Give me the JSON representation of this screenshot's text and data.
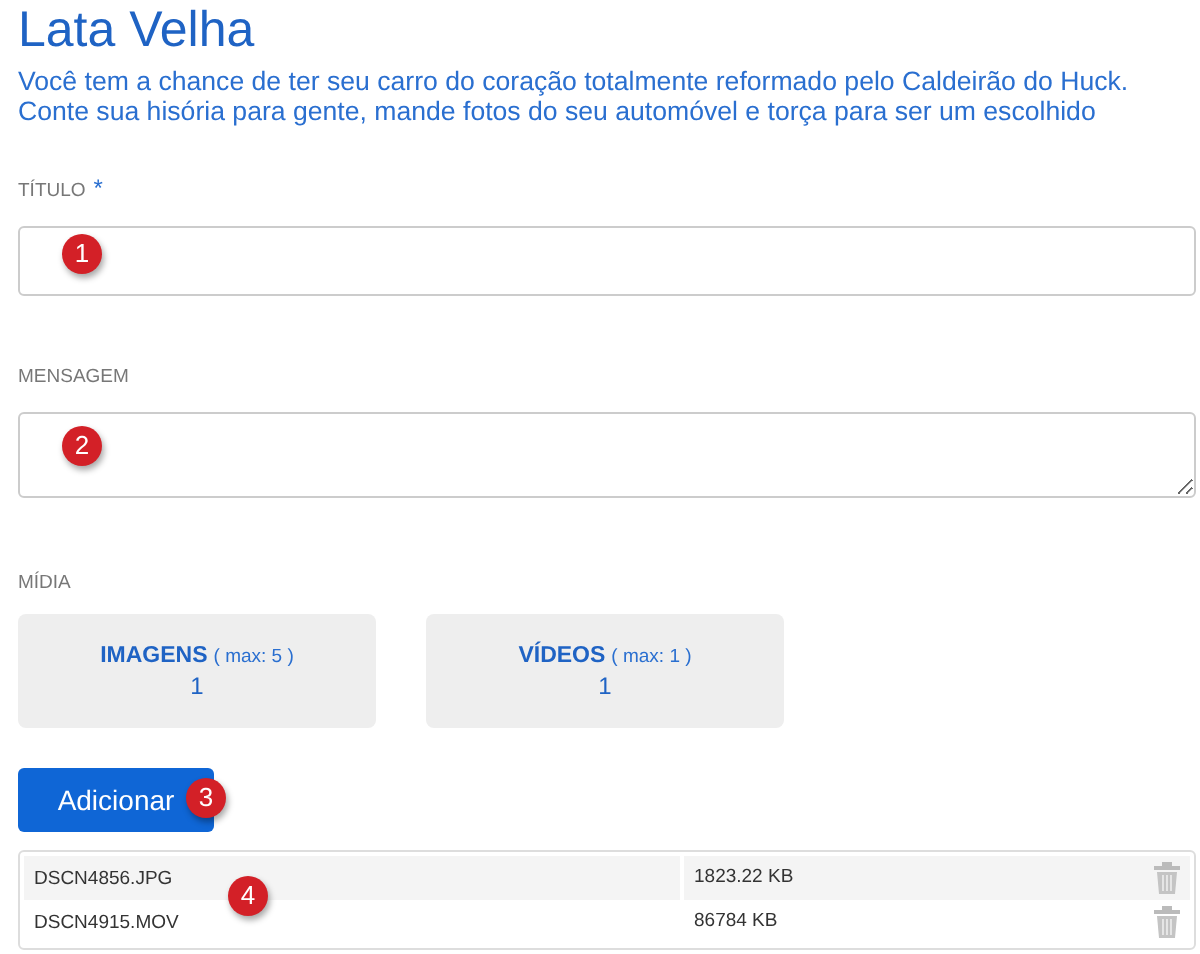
{
  "title": "Lata Velha",
  "description": [
    "Você tem a chance de ter seu carro do coração totalmente reformado pelo Caldeirão do Huck.",
    "Conte sua hisória para gente, mande fotos do seu automóvel e torça para ser um escolhido"
  ],
  "fields": [
    {
      "label": "TÍTULO",
      "required_mark": "*",
      "kind": "input",
      "callout": "1"
    },
    {
      "label": "MENSAGEM",
      "kind": "textarea",
      "callout": "2"
    }
  ],
  "media": {
    "label": "MÍDIA",
    "cards": [
      {
        "name": "IMAGENS",
        "limit": "( max: 5 )",
        "count": "1"
      },
      {
        "name": "VÍDEOS",
        "limit": "( max: 1 )",
        "count": "1"
      }
    ]
  },
  "add_button": {
    "label": "Adicionar",
    "callout": "3"
  },
  "files": {
    "callout": "4",
    "rows": [
      {
        "name": "DSCN4856.JPG",
        "size": "1823.22 KB"
      },
      {
        "name": "DSCN4915.MOV",
        "size": "86784 KB"
      }
    ]
  }
}
